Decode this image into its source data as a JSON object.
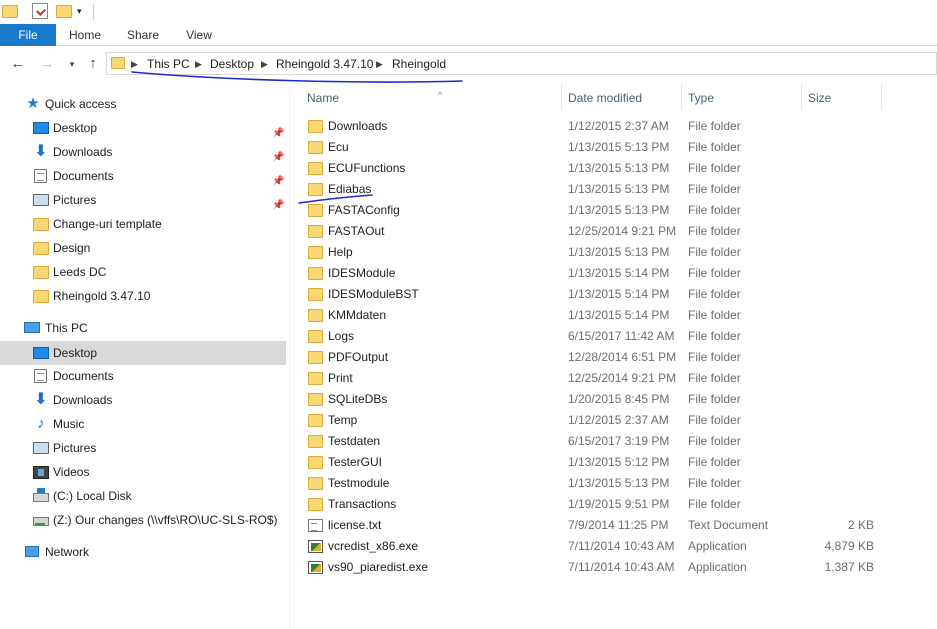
{
  "ribbon": {
    "tabs": [
      "File",
      "Home",
      "Share",
      "View"
    ]
  },
  "address_bar": {
    "crumbs": [
      "This PC",
      "Desktop",
      "Rheingold 3.47.10",
      "Rheingold"
    ]
  },
  "sidebar": {
    "quick_access": "Quick access",
    "quick_items": [
      "Desktop",
      "Downloads",
      "Documents",
      "Pictures",
      "Change-uri template",
      "Design",
      "Leeds DC",
      "Rheingold 3.47.10"
    ],
    "this_pc": "This PC",
    "pc_items": [
      "Desktop",
      "Documents",
      "Downloads",
      "Music",
      "Pictures",
      "Videos",
      "(C:) Local Disk",
      "(Z:) Our changes (\\\\vffs\\RO\\UC-SLS-RO$)"
    ],
    "network": "Network"
  },
  "columns": {
    "name": "Name",
    "date": "Date modified",
    "type": "Type",
    "size": "Size"
  },
  "files": [
    {
      "name": "Downloads",
      "date": "1/12/2015 2:37 AM",
      "type": "File folder",
      "size": "",
      "icon": "folder-icon"
    },
    {
      "name": "Ecu",
      "date": "1/13/2015 5:13 PM",
      "type": "File folder",
      "size": "",
      "icon": "folder-icon"
    },
    {
      "name": "ECUFunctions",
      "date": "1/13/2015 5:13 PM",
      "type": "File folder",
      "size": "",
      "icon": "folder-icon"
    },
    {
      "name": "Ediabas",
      "date": "1/13/2015 5:13 PM",
      "type": "File folder",
      "size": "",
      "icon": "folder-icon"
    },
    {
      "name": "FASTAConfig",
      "date": "1/13/2015 5:13 PM",
      "type": "File folder",
      "size": "",
      "icon": "folder-icon"
    },
    {
      "name": "FASTAOut",
      "date": "12/25/2014 9:21 PM",
      "type": "File folder",
      "size": "",
      "icon": "folder-icon"
    },
    {
      "name": "Help",
      "date": "1/13/2015 5:13 PM",
      "type": "File folder",
      "size": "",
      "icon": "folder-icon"
    },
    {
      "name": "IDESModule",
      "date": "1/13/2015 5:14 PM",
      "type": "File folder",
      "size": "",
      "icon": "folder-icon"
    },
    {
      "name": "IDESModuleBST",
      "date": "1/13/2015 5:14 PM",
      "type": "File folder",
      "size": "",
      "icon": "folder-icon"
    },
    {
      "name": "KMMdaten",
      "date": "1/13/2015 5:14 PM",
      "type": "File folder",
      "size": "",
      "icon": "folder-icon"
    },
    {
      "name": "Logs",
      "date": "6/15/2017 11:42 AM",
      "type": "File folder",
      "size": "",
      "icon": "folder-icon"
    },
    {
      "name": "PDFOutput",
      "date": "12/28/2014 6:51 PM",
      "type": "File folder",
      "size": "",
      "icon": "folder-icon"
    },
    {
      "name": "Print",
      "date": "12/25/2014 9:21 PM",
      "type": "File folder",
      "size": "",
      "icon": "folder-icon"
    },
    {
      "name": "SQLiteDBs",
      "date": "1/20/2015 8:45 PM",
      "type": "File folder",
      "size": "",
      "icon": "folder-icon"
    },
    {
      "name": "Temp",
      "date": "1/12/2015 2:37 AM",
      "type": "File folder",
      "size": "",
      "icon": "folder-icon"
    },
    {
      "name": "Testdaten",
      "date": "6/15/2017 3:19 PM",
      "type": "File folder",
      "size": "",
      "icon": "folder-icon"
    },
    {
      "name": "TesterGUI",
      "date": "1/13/2015 5:12 PM",
      "type": "File folder",
      "size": "",
      "icon": "folder-icon"
    },
    {
      "name": "Testmodule",
      "date": "1/13/2015 5:13 PM",
      "type": "File folder",
      "size": "",
      "icon": "folder-icon"
    },
    {
      "name": "Transactions",
      "date": "1/19/2015 9:51 PM",
      "type": "File folder",
      "size": "",
      "icon": "folder-icon"
    },
    {
      "name": "license.txt",
      "date": "7/9/2014 11:25 PM",
      "type": "Text Document",
      "size": "2 KB",
      "icon": "text-file-icon"
    },
    {
      "name": "vcredist_x86.exe",
      "date": "7/11/2014 10:43 AM",
      "type": "Application",
      "size": "4,879 KB",
      "icon": "application-icon"
    },
    {
      "name": "vs90_piaredist.exe",
      "date": "7/11/2014 10:43 AM",
      "type": "Application",
      "size": "1,387 KB",
      "icon": "application-icon"
    }
  ],
  "colors": {
    "file_tab": "#1979ca",
    "selected_nav": "#d9d9d9",
    "annotation_ink": "#1a2bd6"
  }
}
